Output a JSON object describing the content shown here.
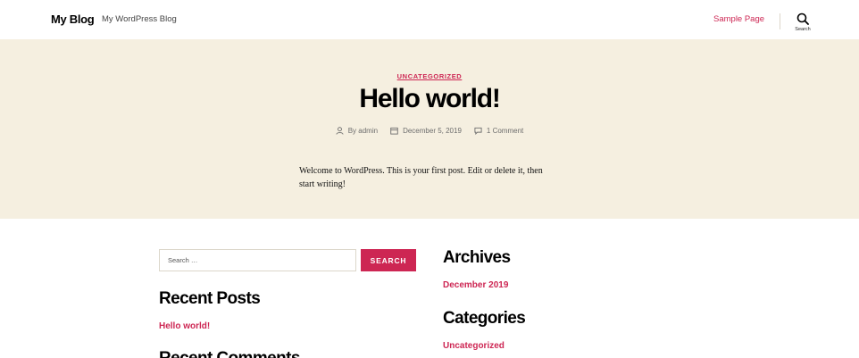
{
  "header": {
    "site_title": "My Blog",
    "site_description": "My WordPress Blog",
    "nav_items": [
      "Sample Page"
    ],
    "search_label": "Search"
  },
  "post": {
    "category": "UNCATEGORIZED",
    "title": "Hello world!",
    "author": "By admin",
    "date": "December 5, 2019",
    "comments": "1 Comment",
    "content": "Welcome to WordPress. This is your first post. Edit or delete it, then start writing!"
  },
  "search_widget": {
    "placeholder": "Search …",
    "submit_label": "SEARCH"
  },
  "recent_posts": {
    "title": "Recent Posts",
    "items": [
      "Hello world!"
    ]
  },
  "recent_comments": {
    "title": "Recent Comments"
  },
  "archives": {
    "title": "Archives",
    "items": [
      "December 2019"
    ]
  },
  "categories": {
    "title": "Categories",
    "items": [
      "Uncategorized"
    ]
  },
  "colors": {
    "accent": "#cd2653",
    "hero_background": "#f5efe0",
    "border": "#dcd7ca"
  }
}
